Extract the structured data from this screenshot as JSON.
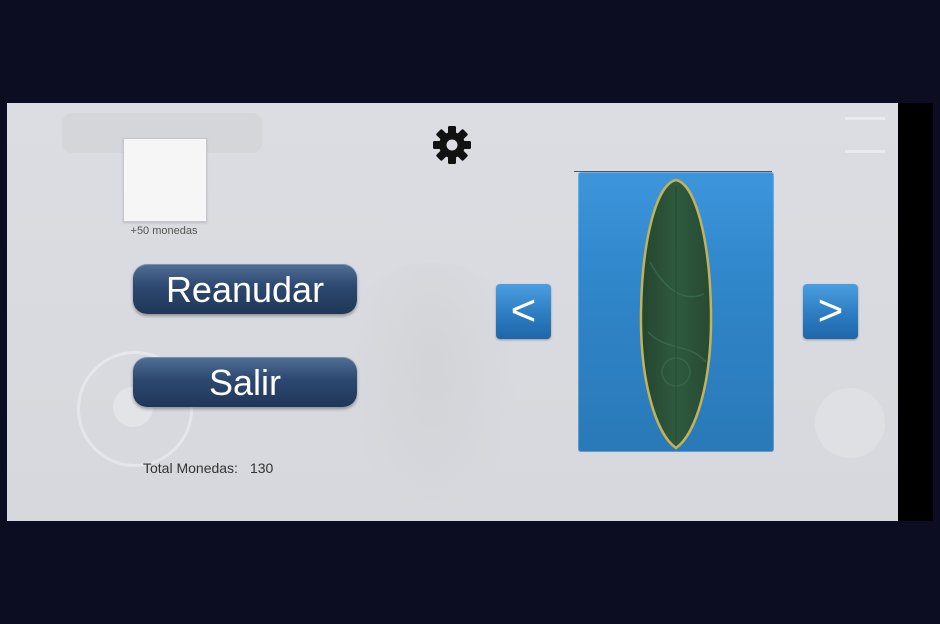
{
  "reward": {
    "label": "+50 monedas"
  },
  "menu": {
    "resume_label": "Reanudar",
    "exit_label": "Salir"
  },
  "coins": {
    "label": "Total Monedas:",
    "value": "130"
  },
  "board_selector": {
    "prev_label": "<",
    "next_label": ">",
    "board_color": "#2f5a3e",
    "board_rim_color": "#c2b25a"
  },
  "icons": {
    "settings": "gear-icon"
  },
  "colors": {
    "background": "#0c0c22",
    "button_primary": "#2d4870",
    "arrow_button": "#2f7fc4",
    "preview_bg": "#3089cc"
  }
}
